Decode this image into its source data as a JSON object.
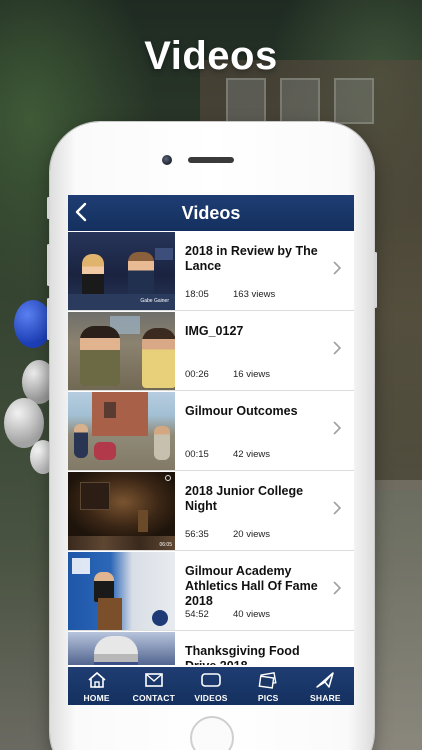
{
  "headline": "Videos",
  "app": {
    "nav_title": "Videos",
    "back_icon": "chevron-left-icon"
  },
  "videos": [
    {
      "title": "2018 in Review by The Lance",
      "duration": "18:05",
      "views": "163 views",
      "thumb_caption": "Gabe Gainer"
    },
    {
      "title": "IMG_0127",
      "duration": "00:26",
      "views": "16 views"
    },
    {
      "title": "Gilmour Outcomes",
      "duration": "00:15",
      "views": "42 views"
    },
    {
      "title": "2018 Junior College Night",
      "duration": "56:35",
      "views": "20 views",
      "thumb_timestamp": "06:05"
    },
    {
      "title": "Gilmour Academy Athletics Hall Of Fame 2018",
      "duration": "54:52",
      "views": "40 views"
    },
    {
      "title": "Thanksgiving Food Drive 2018",
      "duration": "",
      "views": ""
    }
  ],
  "tabs": [
    {
      "label": "HOME",
      "icon": "home-icon"
    },
    {
      "label": "CONTACT",
      "icon": "envelope-icon"
    },
    {
      "label": "VIDEOS",
      "icon": "video-icon"
    },
    {
      "label": "PICS",
      "icon": "photos-icon"
    },
    {
      "label": "SHARE",
      "icon": "share-icon"
    }
  ],
  "colors": {
    "nav_bar": "#1a3768",
    "row_border": "#dcdcdc",
    "chevron": "#a0a0a0"
  }
}
